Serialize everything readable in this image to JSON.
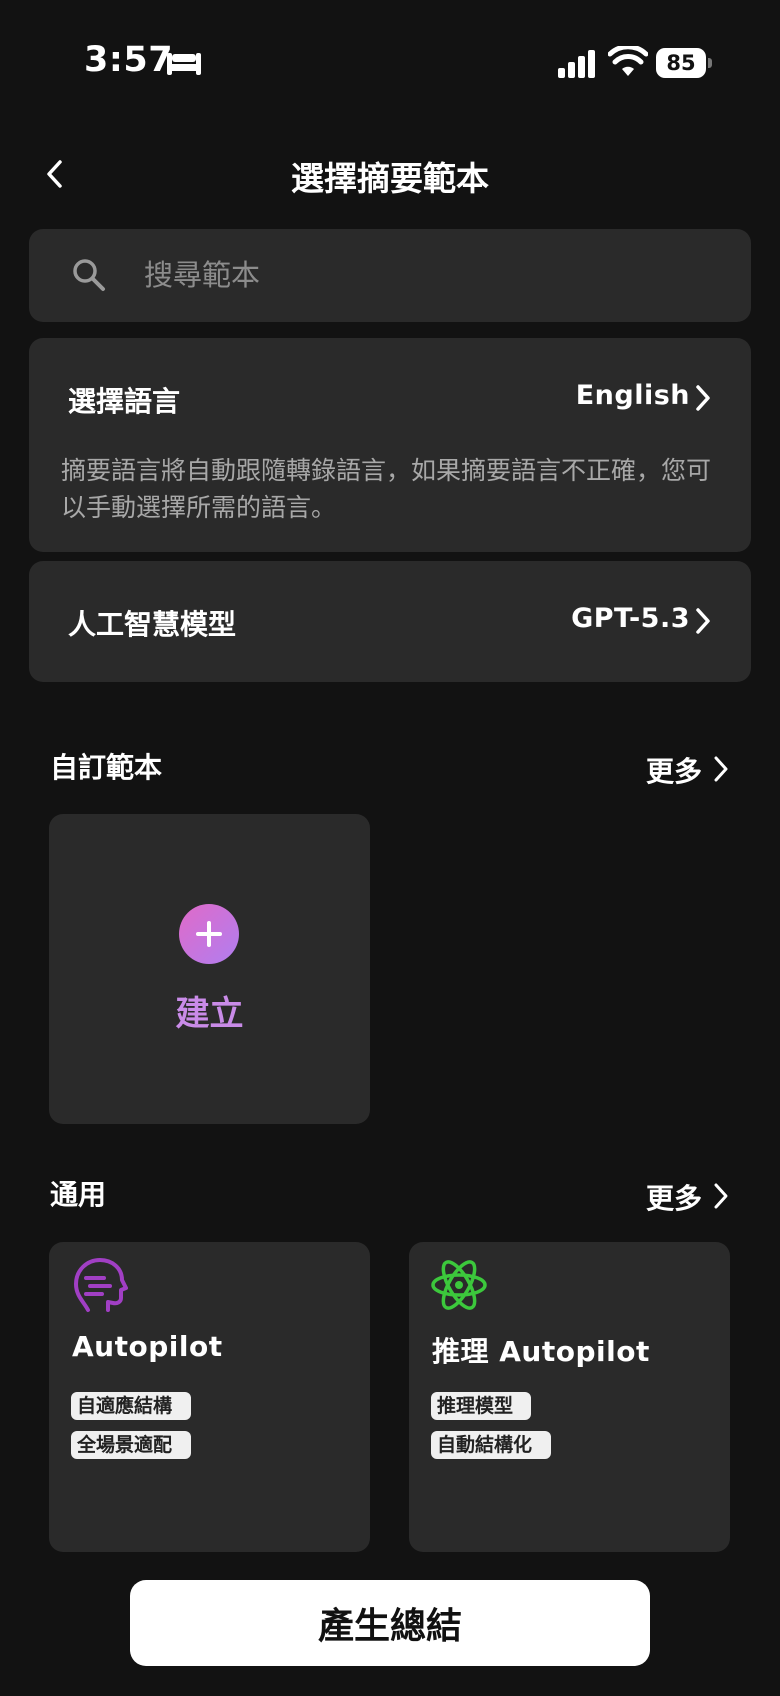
{
  "status_bar": {
    "time": "3:57",
    "battery": "85"
  },
  "header": {
    "title": "選擇摘要範本"
  },
  "search": {
    "placeholder": "搜尋範本"
  },
  "language": {
    "label": "選擇語言",
    "value": "English",
    "description": "摘要語言將自動跟隨轉錄語言，如果摘要語言不正確，您可以手動選擇所需的語言。"
  },
  "model": {
    "label": "人工智慧模型",
    "value": "GPT-5.3"
  },
  "custom_section": {
    "title": "自訂範本",
    "more": "更多",
    "create_label": "建立"
  },
  "general_section": {
    "title": "通用",
    "more": "更多",
    "templates": [
      {
        "name": "Autopilot",
        "tags": [
          "自適應結構",
          "全場景適配"
        ],
        "accent": "#a13fc4"
      },
      {
        "name": "推理 Autopilot",
        "tags": [
          "推理模型",
          "自動結構化"
        ],
        "accent": "#3cc83c"
      }
    ]
  },
  "footer": {
    "generate_label": "產生總結"
  }
}
